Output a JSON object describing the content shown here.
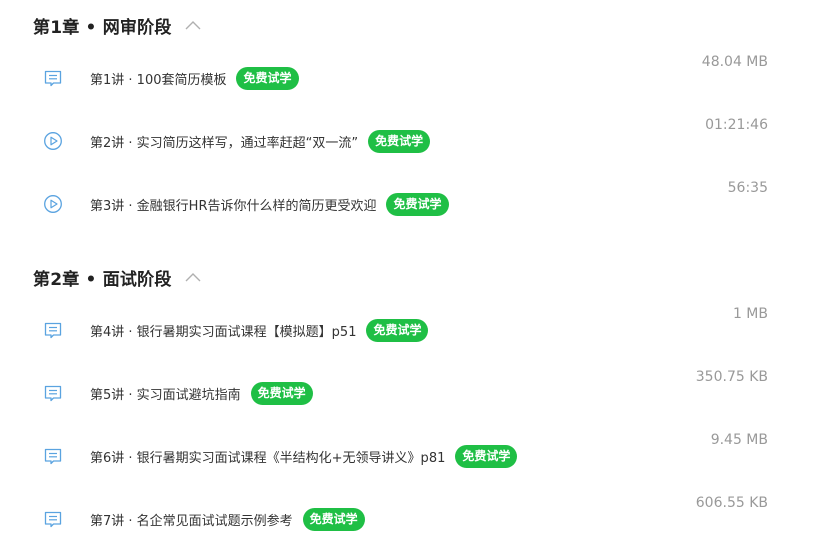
{
  "chapters": [
    {
      "title": "第1章 • 网审阶段",
      "lessons": [
        {
          "title": "第1讲 · 100套简历模板",
          "badge": "免费试学",
          "meta": "48.04 MB",
          "icon": "document-icon"
        },
        {
          "title": "第2讲 · 实习简历这样写，通过率赶超“双一流”",
          "badge": "免费试学",
          "meta": "01:21:46",
          "icon": "play-icon"
        },
        {
          "title": "第3讲 · 金融银行HR告诉你什么样的简历更受欢迎",
          "badge": "免费试学",
          "meta": "56:35",
          "icon": "play-icon"
        }
      ]
    },
    {
      "title": "第2章 • 面试阶段",
      "lessons": [
        {
          "title": "第4讲 · 银行暑期实习面试课程【模拟题】p51",
          "badge": "免费试学",
          "meta": "1 MB",
          "icon": "document-icon"
        },
        {
          "title": "第5讲 · 实习面试避坑指南",
          "badge": "免费试学",
          "meta": "350.75 KB",
          "icon": "document-icon"
        },
        {
          "title": "第6讲 · 银行暑期实习面试课程《半结构化+无领导讲义》p81",
          "badge": "免费试学",
          "meta": "9.45 MB",
          "icon": "document-icon"
        },
        {
          "title": "第7讲 · 名企常见面试试题示例参考",
          "badge": "免费试学",
          "meta": "606.55 KB",
          "icon": "document-icon"
        }
      ]
    }
  ],
  "colors": {
    "accent": "#1fbf45",
    "icon": "#5aa3e0",
    "meta": "#999999"
  }
}
